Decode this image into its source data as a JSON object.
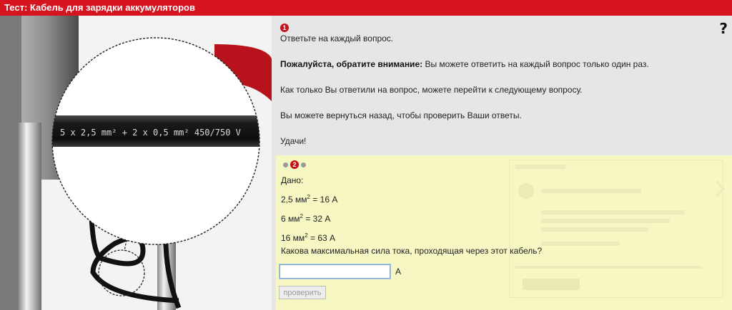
{
  "window": {
    "title": "Тест: Кабель для зарядки аккумуляторов"
  },
  "intro": {
    "step": "1",
    "line1": "Ответьте на каждый вопрос.",
    "note_bold": "Пожалуйста, обратите внимание:",
    "note_text": " Вы можете ответить на каждый вопрос только один раз.",
    "line3": "Как только Вы ответили на вопрос, можете перейти к следующему вопросу.",
    "line4": "Вы можете вернуться назад, чтобы проверить Ваши ответы.",
    "line5": "Удачи!"
  },
  "help_label": "?",
  "image": {
    "cable_label": "5 x 2,5 mm² + 2 x 0,5 mm² 450/750 V"
  },
  "task": {
    "current_step": "2",
    "given_title": "Дано:",
    "given": [
      {
        "lhs": "2,5 мм",
        "exp": "2",
        "rhs": " = 16 А"
      },
      {
        "lhs": "6 мм",
        "exp": "2",
        "rhs": " = 32 А"
      },
      {
        "lhs": "16 мм",
        "exp": "2",
        "rhs": " = 63 А"
      }
    ],
    "question": "Какова максимальная сила тока, проходящая через этот кабель?",
    "answer_value": "",
    "unit": "А",
    "check_label": "проверить"
  },
  "colors": {
    "brand_red": "#d6141f",
    "task_bg": "#f7f7c4",
    "panel_bg": "#e6e6e6"
  }
}
